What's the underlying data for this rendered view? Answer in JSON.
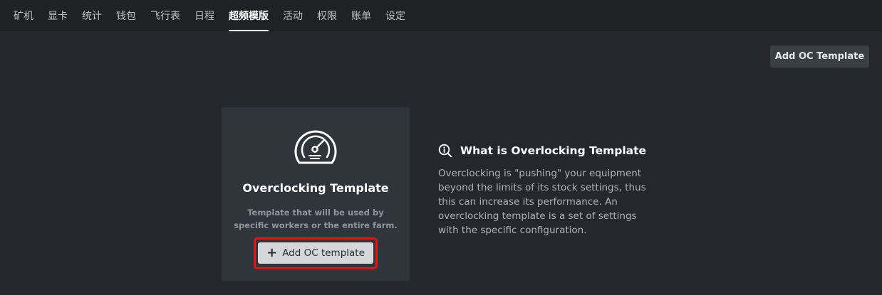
{
  "nav": {
    "tabs": [
      {
        "label": "矿机"
      },
      {
        "label": "显卡"
      },
      {
        "label": "统计"
      },
      {
        "label": "钱包"
      },
      {
        "label": "飞行表"
      },
      {
        "label": "日程"
      },
      {
        "label": "超频模版"
      },
      {
        "label": "活动"
      },
      {
        "label": "权限"
      },
      {
        "label": "账单"
      },
      {
        "label": "设定"
      }
    ],
    "active_index": 6
  },
  "header": {
    "add_button_label": "Add OC Template"
  },
  "card": {
    "icon": "gauge-icon",
    "title": "Overclocking Template",
    "description": "Template that will be used by specific workers or the entire farm.",
    "button_icon": "plus-icon",
    "button_label": "Add OC template"
  },
  "info": {
    "icon": "search-info-icon",
    "title": "What is Overlocking Template",
    "text": "Overclocking is \"pushing\" your equipment beyond the limits of its stock settings, thus this can increase its performance. An overclocking template is a set of settings with the specific configuration."
  },
  "colors": {
    "page_bg": "#25272c",
    "nav_bg": "#1f2125",
    "card_bg": "#30343b",
    "highlight": "#e51515",
    "button_light": "#d5d7db",
    "button_dark": "#3a3e45"
  }
}
